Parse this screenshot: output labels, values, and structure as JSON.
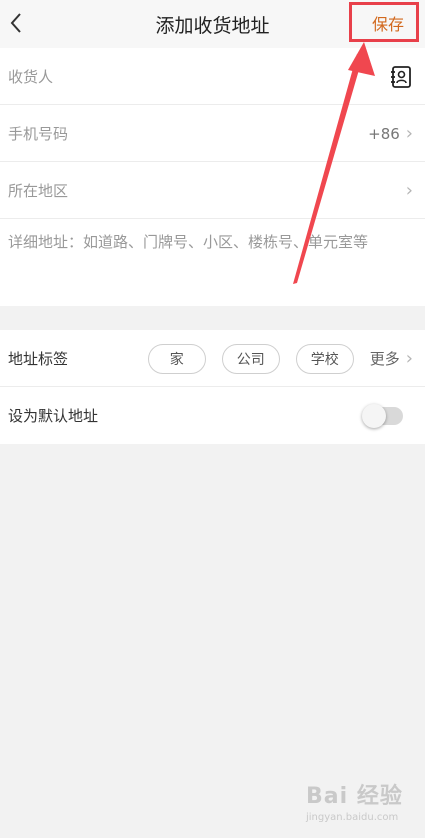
{
  "header": {
    "title": "添加收货地址",
    "save_label": "保存"
  },
  "form": {
    "recipient_placeholder": "收货人",
    "phone_placeholder": "手机号码",
    "country_code": "+86",
    "region_placeholder": "所在地区",
    "detail_placeholder": "详细地址：如道路、门牌号、小区、楼栋号、单元室等"
  },
  "tags": {
    "label": "地址标签",
    "items": [
      "家",
      "公司",
      "学校"
    ],
    "more_label": "更多"
  },
  "default_address": {
    "label": "设为默认地址",
    "enabled": false
  },
  "watermark": {
    "main": "Bai 经验",
    "sub": "jingyan.baidu.com"
  },
  "colors": {
    "accent": "#d2691e",
    "highlight_box": "#e8404a",
    "arrow": "#f0474f"
  },
  "icons": {
    "back": "chevron-left-icon",
    "contacts": "contact-book-icon",
    "chevron": "chevron-right-icon"
  }
}
